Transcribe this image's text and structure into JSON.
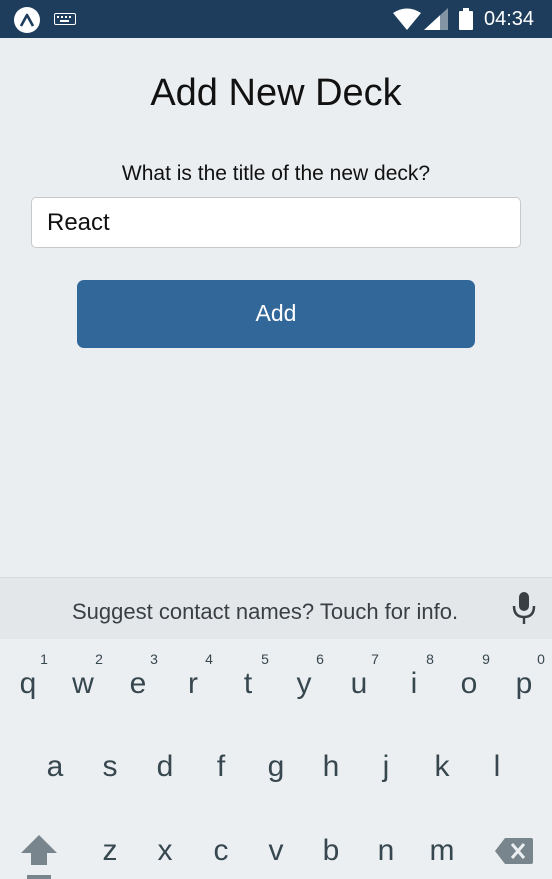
{
  "status_bar": {
    "time": "04:34",
    "icons": [
      "expo-icon",
      "keyboard-icon",
      "wifi-icon",
      "signal-icon",
      "battery-icon"
    ]
  },
  "screen": {
    "title": "Add New Deck",
    "question": "What is the title of the new deck?",
    "input_value": "React",
    "add_button": "Add"
  },
  "keyboard": {
    "suggestion": "Suggest contact names? Touch for info.",
    "row1": [
      {
        "key": "q",
        "hint": "1"
      },
      {
        "key": "w",
        "hint": "2"
      },
      {
        "key": "e",
        "hint": "3"
      },
      {
        "key": "r",
        "hint": "4"
      },
      {
        "key": "t",
        "hint": "5"
      },
      {
        "key": "y",
        "hint": "6"
      },
      {
        "key": "u",
        "hint": "7"
      },
      {
        "key": "i",
        "hint": "8"
      },
      {
        "key": "o",
        "hint": "9"
      },
      {
        "key": "p",
        "hint": "0"
      }
    ],
    "row2": [
      "a",
      "s",
      "d",
      "f",
      "g",
      "h",
      "j",
      "k",
      "l"
    ],
    "row3": [
      "z",
      "x",
      "c",
      "v",
      "b",
      "n",
      "m"
    ],
    "icons": [
      "mic-icon",
      "shift-icon",
      "backspace-icon"
    ]
  }
}
